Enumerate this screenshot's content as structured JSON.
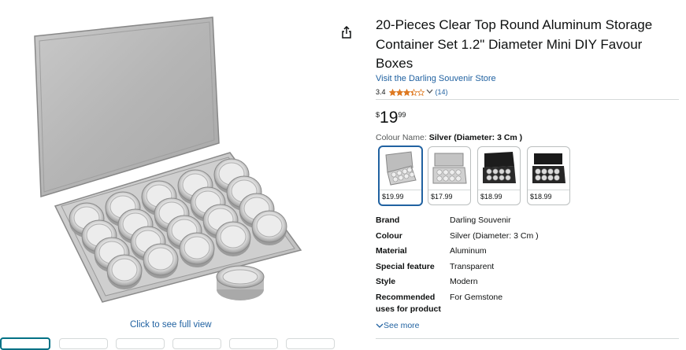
{
  "product": {
    "title": "20-Pieces Clear Top Round Aluminum Storage Container Set 1.2\" Diameter Mini DIY Favour Boxes",
    "store_link": "Visit the Darling Souvenir Store",
    "rating": "3.4",
    "stars": 3.4,
    "review_count": "(14)",
    "price": {
      "currency": "$",
      "whole": "19",
      "fraction": "99"
    }
  },
  "colour": {
    "label": "Colour Name: ",
    "selected": "Silver (Diameter: 3 Cm )",
    "swatches": [
      {
        "price": "$19.99",
        "selected": true,
        "style": "silver-open"
      },
      {
        "price": "$17.99",
        "selected": false,
        "style": "silver-open"
      },
      {
        "price": "$18.99",
        "selected": false,
        "style": "black-open"
      },
      {
        "price": "$18.99",
        "selected": false,
        "style": "black-open"
      }
    ]
  },
  "specs": [
    {
      "key": "Brand",
      "value": "Darling Souvenir"
    },
    {
      "key": "Colour",
      "value": "Silver (Diameter: 3 Cm )"
    },
    {
      "key": "Material",
      "value": "Aluminum"
    },
    {
      "key": "Special feature",
      "value": "Transparent"
    },
    {
      "key": "Style",
      "value": "Modern"
    },
    {
      "key": "Recommended uses for product",
      "value": "For Gemstone"
    }
  ],
  "see_more": "See more",
  "image": {
    "click_to_see": "Click to see full view"
  },
  "colors": {
    "link": "#2162a1",
    "star": "#de7921",
    "selected_border": "#2162a1"
  }
}
